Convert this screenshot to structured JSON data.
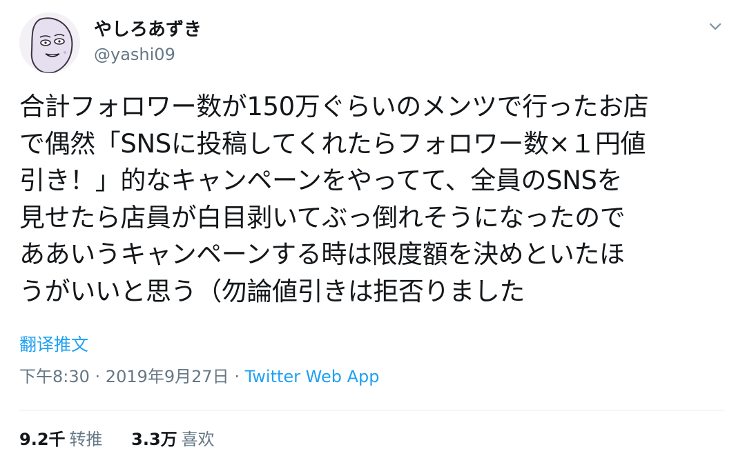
{
  "author": {
    "display_name": "やしろあずき",
    "handle": "@yashi09"
  },
  "tweet": {
    "lines": [
      "合計フォロワー数が150万ぐらいのメンツで行ったお店",
      "で偶然「SNSに投稿してくれたらフォロワー数×１円値",
      "引き！」的なキャンペーンをやってて、全員のSNSを",
      "見せたら店員が白目剥いてぶっ倒れそうになったので",
      "ああいうキャンペーンする時は限度額を決めといたほ",
      "うがいいと思う（勿論値引きは拒否りました"
    ],
    "translate_label": "翻译推文",
    "time": "下午8:30",
    "separator": " · ",
    "date": "2019年9月27日",
    "source": "Twitter Web App"
  },
  "stats": {
    "retweets_count": "9.2千",
    "retweets_label": "转推",
    "likes_count": "3.3万",
    "likes_label": "喜欢"
  },
  "icons": {
    "caret": "chevron-down-icon",
    "avatar": "avatar-illustration"
  }
}
